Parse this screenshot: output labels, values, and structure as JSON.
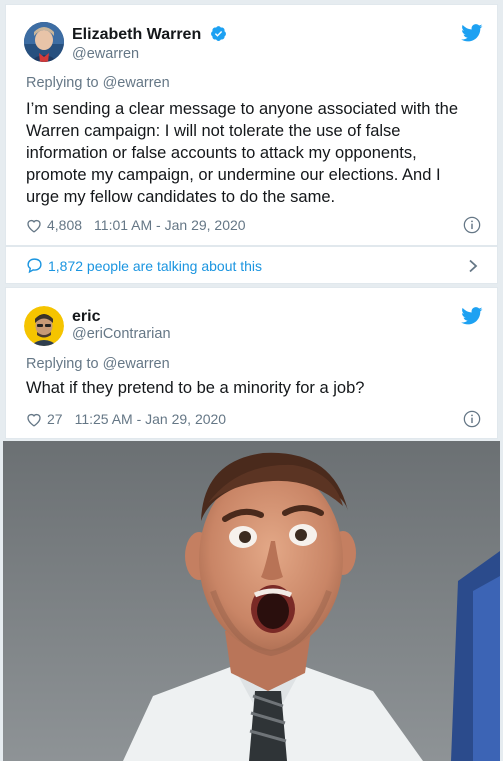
{
  "tweet1": {
    "name": "Elizabeth Warren",
    "handle": "@ewarren",
    "reply_prefix": "Replying to ",
    "reply_to": "@ewarren",
    "text": "I’m sending a clear message to anyone associated with the Warren campaign: I will not tolerate the use of false information or false accounts to attack my opponents, promote my campaign, or undermine our elections. And I urge my fellow candidates to do the same.",
    "likes": "4,808",
    "timestamp": "11:01 AM - Jan 29, 2020"
  },
  "talking": {
    "label": "1,872 people are talking about this"
  },
  "tweet2": {
    "name": "eric",
    "handle": "@eriContrarian",
    "reply_prefix": "Replying to ",
    "reply_to": "@ewarren",
    "text": "What if they pretend to be a minority for a job?",
    "likes": "27",
    "timestamp": "11:25 AM - Jan 29, 2020"
  },
  "colors": {
    "twitter_blue": "#1da1f2",
    "link_blue": "#1b95e0",
    "secondary_text": "#657786",
    "avatar2_yellow": "#f5c400"
  },
  "icons": {
    "verified": "verified-badge-icon",
    "bird": "twitter-bird-icon",
    "like": "heart-icon",
    "info": "info-icon",
    "comment": "speech-bubble-icon",
    "chevron": "chevron-right-icon"
  }
}
